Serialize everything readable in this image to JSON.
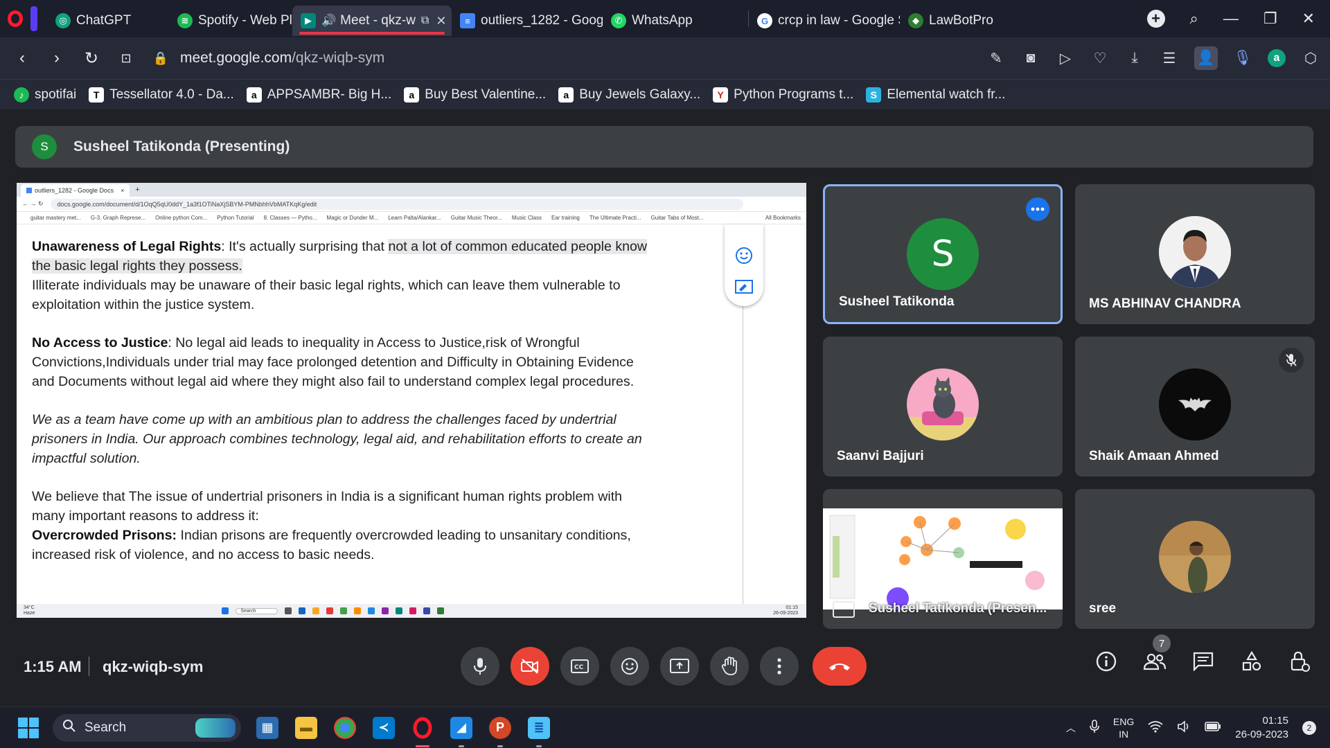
{
  "browser": {
    "tabs": [
      {
        "title": "ChatGPT",
        "icon": "chatgpt-icon",
        "color": "#10a37f"
      },
      {
        "title": "Spotify - Web Player:",
        "icon": "spotify-icon",
        "color": "#1db954"
      },
      {
        "title": "Meet - qkz-w",
        "icon": "meet-icon",
        "color": "#00897b",
        "active": true
      },
      {
        "title": "outliers_1282 - Googl",
        "icon": "docs-icon",
        "color": "#4285f4"
      },
      {
        "title": "WhatsApp",
        "icon": "whatsapp-icon",
        "color": "#25d366"
      },
      {
        "title": "crcp in law - Google S",
        "icon": "google-icon",
        "color": "#ea4335"
      },
      {
        "title": "LawBotPro",
        "icon": "lawbotpro-icon",
        "color": "#4caf50"
      }
    ],
    "url_domain": "meet.google.com",
    "url_path": "/qkz-wiqb-sym",
    "bookmarks": [
      {
        "label": "spotifai",
        "color": "#1db954",
        "glyph": "♪"
      },
      {
        "label": "Tessellator 4.0 - Da...",
        "color": "#ffffff",
        "glyph": "T"
      },
      {
        "label": "APPSAMBR- Big H...",
        "color": "#ffffff",
        "glyph": "a"
      },
      {
        "label": "Buy Best Valentine...",
        "color": "#ffffff",
        "glyph": "a"
      },
      {
        "label": "Buy Jewels Galaxy...",
        "color": "#ffffff",
        "glyph": "a"
      },
      {
        "label": "Python Programs t...",
        "color": "#ffffff",
        "glyph": "Y"
      },
      {
        "label": "Elemental watch fr...",
        "color": "#2bb3e0",
        "glyph": "S"
      }
    ]
  },
  "meet": {
    "presenter_initial": "S",
    "presenter_label": "Susheel Tatikonda (Presenting)",
    "time": "1:15 AM",
    "meeting_code": "qkz-wiqb-sym",
    "participant_count": "7",
    "participants": [
      {
        "name": "Susheel Tatikonda",
        "avatar": "S",
        "active": true
      },
      {
        "name": "MS ABHINAV CHANDRA"
      },
      {
        "name": "Saanvi Bajjuri"
      },
      {
        "name": "Shaik Amaan Ahmed",
        "muted": true
      },
      {
        "name": "Susheel Tatikonda (Presen..."
      },
      {
        "name": "sree"
      }
    ]
  },
  "shared_doc": {
    "tab_title": "outliers_1282 - Google Docs",
    "url": "docs.google.com/document/d/1OqQ5qU0ddY_1a3f1OTiNaXjSBYM-PMNbhhVbMATKqKg/edit",
    "bookmarks": [
      "guitar mastery met...",
      "G-3. Graph Represe...",
      "Online python Com...",
      "Python Tutorial",
      "8. Classes — Pytho...",
      "Magic or Dunder M...",
      "Learn Palta/Alankar...",
      "Guitar Music Theor...",
      "Music Class",
      "Ear training",
      "The Ultimate Practi...",
      "Guitar Tabs of Most...",
      "All Bookmarks"
    ],
    "p1_title": "Unawareness of Legal Rights",
    "p1_text_a": ": It's actually surprising that ",
    "p1_highlight": "not a lot of common educated people know the basic legal rights they possess.",
    "p1_text_b": "Illiterate individuals may be unaware of their basic legal rights, which can leave them vulnerable to exploitation within the justice system.",
    "p2_title": "No Access to Justice",
    "p2_text": ": No legal aid leads to inequality in Access to Justice,risk of Wrongful Convictions,Individuals  under trial may face prolonged detention and Difficulty in Obtaining Evidence and Documents without legal aid where they might also fail to understand complex legal procedures.",
    "p3_text": "We as a team have come up with an ambitious plan to address the challenges faced by undertrial prisoners in India. Our approach combines technology, legal aid, and rehabilitation efforts to create an impactful solution.",
    "p4_text": "We believe that The issue of undertrial prisoners in India is a significant human rights problem with many important reasons to address it:",
    "p5_title": "Overcrowded Prisons:",
    "p5_text": " Indian prisons are frequently overcrowded leading to unsanitary conditions, increased risk of violence, and no access to basic needs.",
    "taskbar_weather": "34°C",
    "taskbar_weather_sub": "Haze",
    "taskbar_search": "Search",
    "taskbar_time": "01:15",
    "taskbar_date": "26-09-2023"
  },
  "taskbar": {
    "search_label": "Search",
    "lang_top": "ENG",
    "lang_bottom": "IN",
    "time": "01:15",
    "date": "26-09-2023",
    "notifications": "2"
  }
}
